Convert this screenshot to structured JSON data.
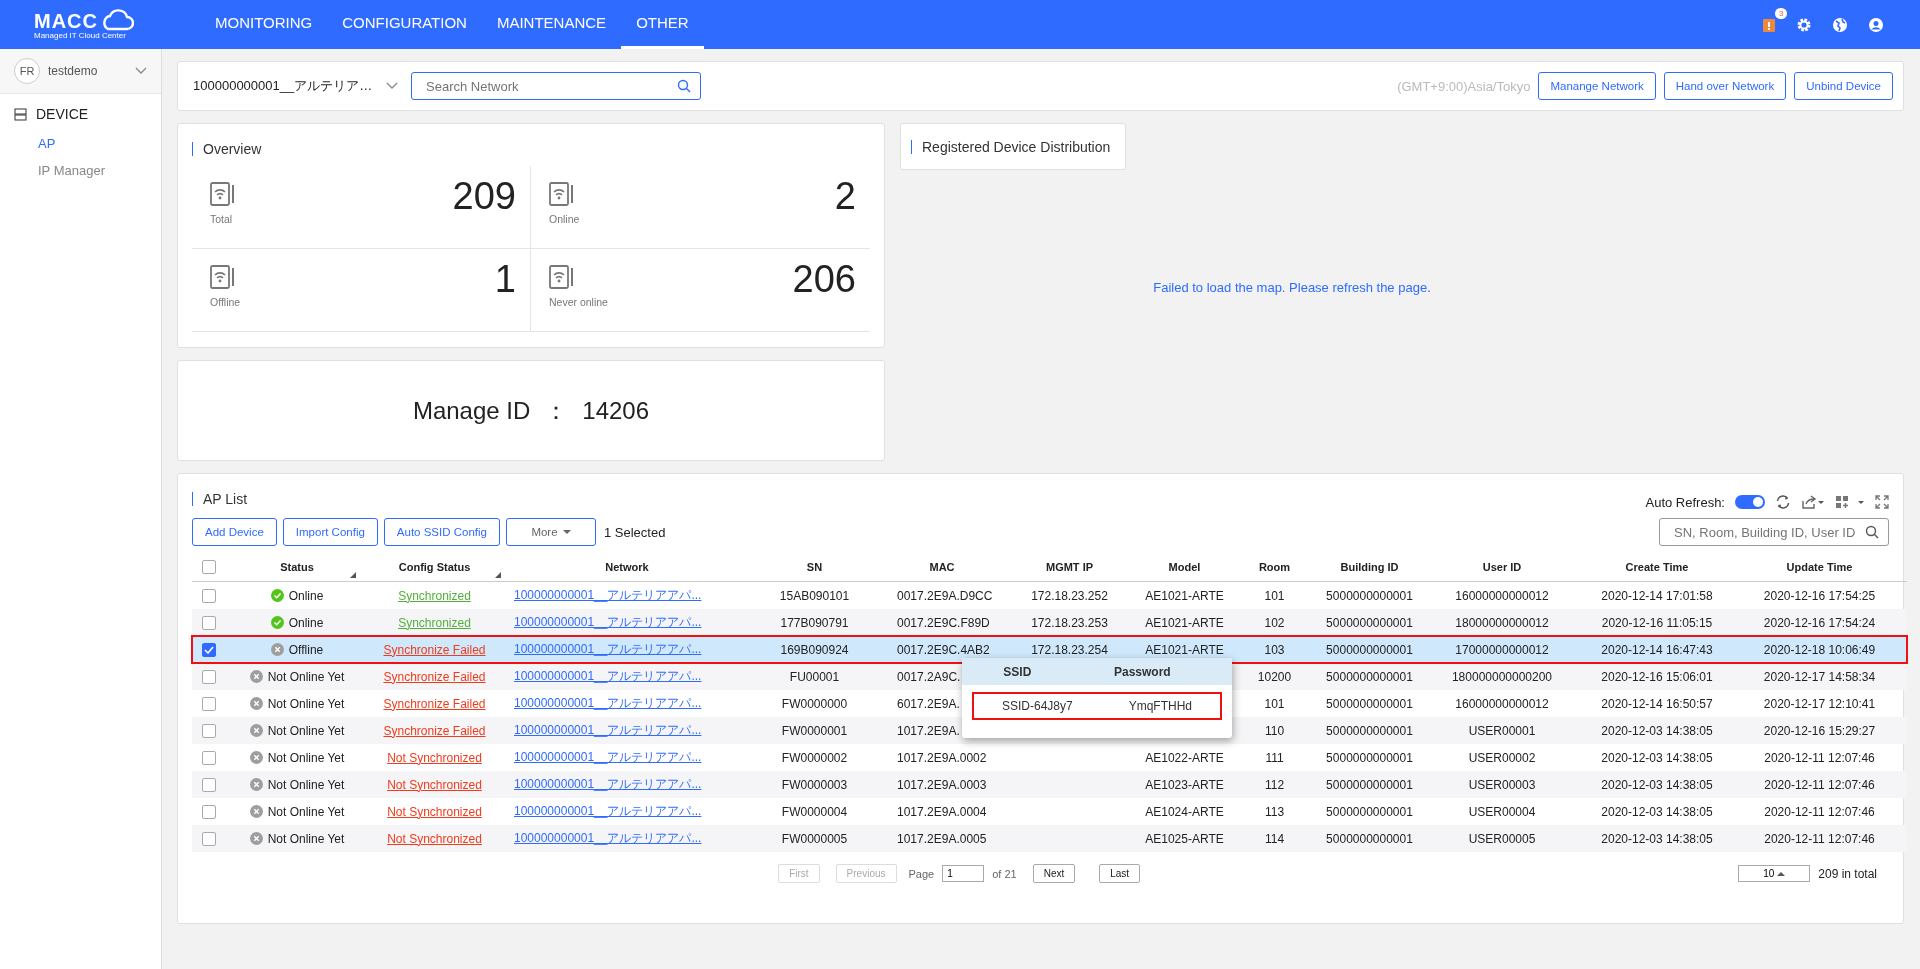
{
  "header": {
    "logo": "MACC",
    "logo_sub": "Managed IT Cloud Center",
    "nav": [
      {
        "label": "MONITORING",
        "selected": false
      },
      {
        "label": "CONFIGURATION",
        "selected": false
      },
      {
        "label": "MAINTENANCE",
        "selected": false
      },
      {
        "label": "OTHER",
        "selected": true
      }
    ],
    "notification_count": "3"
  },
  "sidebar": {
    "user": "testdemo",
    "avatar": "FR",
    "section": "DEVICE",
    "items": [
      {
        "label": "AP",
        "selected": true
      },
      {
        "label": "IP Manager",
        "selected": false
      }
    ]
  },
  "topbar": {
    "network": "100000000001__アルテリア…",
    "search": {
      "placeholder": "Search Network"
    },
    "timezone": "(GMT+9:00)Asia/Tokyo",
    "buttons": [
      "Manange Network",
      "Hand over Network",
      "Unbind Device"
    ]
  },
  "overview": {
    "title": "Overview",
    "stats": [
      {
        "label": "Total",
        "value": "209"
      },
      {
        "label": "Online",
        "value": "2"
      },
      {
        "label": "Offline",
        "value": "1"
      },
      {
        "label": "Never online",
        "value": "206"
      }
    ]
  },
  "manage_id": {
    "label": "Manage ID",
    "separator": "：",
    "value": "14206"
  },
  "distribution": {
    "title": "Registered Device Distribution",
    "message": "Failed to load the map. Please refresh the page."
  },
  "ap_list": {
    "title": "AP List",
    "auto_refresh": {
      "label": "Auto Refresh:",
      "on": true
    },
    "buttons": [
      "Add Device",
      "Import Config",
      "Auto SSID Config"
    ],
    "more": "More",
    "selected_count": "1 Selected",
    "search": {
      "placeholder": "SN, Room, Building ID, User ID"
    },
    "all_selected": false,
    "columns": [
      "Status",
      "Config Status",
      "Network",
      "SN",
      "MAC",
      "MGMT IP",
      "Model",
      "Room",
      "Building ID",
      "User ID",
      "Create Time",
      "Update Time"
    ],
    "rows": [
      {
        "selected": false,
        "status": {
          "kind": "online",
          "text": "Online"
        },
        "config": {
          "kind": "ok",
          "text": "Synchronized"
        },
        "network": "100000000001__アルテリアアパ...",
        "sn": "15AB090101",
        "mac": "0017.2E9A.D9CC",
        "ip": "172.18.23.252",
        "model": "AE1021-ARTE",
        "room": "101",
        "building": "5000000000001",
        "user": "16000000000012",
        "created": "2020-12-14 17:01:58",
        "updated": "2020-12-16 17:54:25"
      },
      {
        "selected": false,
        "status": {
          "kind": "online",
          "text": "Online"
        },
        "config": {
          "kind": "ok",
          "text": "Synchronized"
        },
        "network": "100000000001__アルテリアアパ...",
        "sn": "177B090791",
        "mac": "0017.2E9C.F89D",
        "ip": "172.18.23.253",
        "model": "AE1021-ARTE",
        "room": "102",
        "building": "5000000000001",
        "user": "18000000000012",
        "created": "2020-12-16 11:05:15",
        "updated": "2020-12-16 17:54:24"
      },
      {
        "selected": true,
        "status": {
          "kind": "offline",
          "text": "Offline"
        },
        "config": {
          "kind": "error",
          "text": "Synchronize Failed"
        },
        "network": "100000000001__アルテリアアパ...",
        "sn": "169B090924",
        "mac": "0017.2E9C.4AB2",
        "ip": "172.18.23.254",
        "model": "AE1021-ARTE",
        "room": "103",
        "building": "5000000000001",
        "user": "17000000000012",
        "created": "2020-12-14 16:47:43",
        "updated": "2020-12-18 10:06:49"
      },
      {
        "selected": false,
        "status": {
          "kind": "offline",
          "text": "Not Online Yet"
        },
        "config": {
          "kind": "error",
          "text": "Synchronize Failed"
        },
        "network": "100000000001__アルテリアアパ...",
        "sn": "FU00001",
        "mac": "0017.2A9C.",
        "room": "10200",
        "building": "5000000000001",
        "user": "180000000000200",
        "created": "2020-12-16 15:06:01",
        "updated": "2020-12-17 14:58:34"
      },
      {
        "selected": false,
        "status": {
          "kind": "offline",
          "text": "Not Online Yet"
        },
        "config": {
          "kind": "error",
          "text": "Synchronize Failed"
        },
        "network": "100000000001__アルテリアアパ...",
        "sn": "FW0000000",
        "mac": "6017.2E9A.",
        "room": "101",
        "building": "5000000000001",
        "user": "16000000000012",
        "created": "2020-12-14 16:50:57",
        "updated": "2020-12-17 12:10:41"
      },
      {
        "selected": false,
        "status": {
          "kind": "offline",
          "text": "Not Online Yet"
        },
        "config": {
          "kind": "error",
          "text": "Synchronize Failed"
        },
        "network": "100000000001__アルテリアアパ...",
        "sn": "FW0000001",
        "mac": "1017.2E9A.",
        "room": "110",
        "building": "5000000000001",
        "user": "USER00001",
        "created": "2020-12-03 14:38:05",
        "updated": "2020-12-16 15:29:27"
      },
      {
        "selected": false,
        "status": {
          "kind": "offline",
          "text": "Not Online Yet"
        },
        "config": {
          "kind": "error",
          "text": "Not Synchronized"
        },
        "network": "100000000001__アルテリアアパ...",
        "sn": "FW0000002",
        "mac": "1017.2E9A.0002",
        "model": "AE1022-ARTE",
        "room": "111",
        "building": "5000000000001",
        "user": "USER00002",
        "created": "2020-12-03 14:38:05",
        "updated": "2020-12-11 12:07:46"
      },
      {
        "selected": false,
        "status": {
          "kind": "offline",
          "text": "Not Online Yet"
        },
        "config": {
          "kind": "error",
          "text": "Not Synchronized"
        },
        "network": "100000000001__アルテリアアパ...",
        "sn": "FW0000003",
        "mac": "1017.2E9A.0003",
        "model": "AE1023-ARTE",
        "room": "112",
        "building": "5000000000001",
        "user": "USER00003",
        "created": "2020-12-03 14:38:05",
        "updated": "2020-12-11 12:07:46"
      },
      {
        "selected": false,
        "status": {
          "kind": "offline",
          "text": "Not Online Yet"
        },
        "config": {
          "kind": "error",
          "text": "Not Synchronized"
        },
        "network": "100000000001__アルテリアアパ...",
        "sn": "FW0000004",
        "mac": "1017.2E9A.0004",
        "model": "AE1024-ARTE",
        "room": "113",
        "building": "5000000000001",
        "user": "USER00004",
        "created": "2020-12-03 14:38:05",
        "updated": "2020-12-11 12:07:46"
      },
      {
        "selected": false,
        "status": {
          "kind": "offline",
          "text": "Not Online Yet"
        },
        "config": {
          "kind": "error",
          "text": "Not Synchronized"
        },
        "network": "100000000001__アルテリアアパ...",
        "sn": "FW0000005",
        "mac": "1017.2E9A.0005",
        "model": "AE1025-ARTE",
        "room": "114",
        "building": "5000000000001",
        "user": "USER00005",
        "created": "2020-12-03 14:38:05",
        "updated": "2020-12-11 12:07:46"
      }
    ],
    "popover": {
      "columns": [
        "SSID",
        "Password"
      ],
      "ssid": "SSID-64J8y7",
      "password": "YmqFTHHd"
    },
    "pagination": {
      "first": "First",
      "previous": "Previous",
      "page_label": "Page",
      "page": "1",
      "of": "of 21",
      "next": "Next",
      "last": "Last",
      "page_size": "10",
      "total": "209 in total"
    }
  }
}
